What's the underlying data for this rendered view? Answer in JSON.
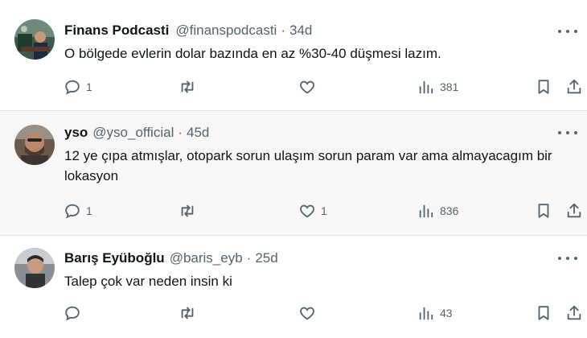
{
  "tweets": [
    {
      "name": "Finans Podcasti",
      "handle": "@finanspodcasti",
      "separator": "·",
      "time": "34d",
      "text": "O bölgede evlerin dolar bazında en az %30-40 düşmesi lazım.",
      "replies": "1",
      "retweets": "",
      "likes": "",
      "views": "381"
    },
    {
      "name": "yso",
      "handle": "@yso_official",
      "separator": "·",
      "time": "45d",
      "text": "12 ye çıpa atmışlar, otopark sorun ulaşım sorun param var ama almayacagım bir lokasyon",
      "replies": "1",
      "retweets": "",
      "likes": "1",
      "views": "836"
    },
    {
      "name": "Barış Eyüboğlu",
      "handle": "@baris_eyb",
      "separator": "·",
      "time": "25d",
      "text": "Talep çok var neden insin ki",
      "replies": "",
      "retweets": "",
      "likes": "",
      "views": "43"
    }
  ],
  "icons": {
    "reply": "reply-icon",
    "retweet": "retweet-icon",
    "like": "heart-icon",
    "views": "views-chart-icon",
    "bookmark": "bookmark-icon",
    "share": "share-icon",
    "more": "more-dots-icon"
  },
  "colors": {
    "text": "#0f1419",
    "secondary": "#536471",
    "highlighted_bg": "#f7f7f7",
    "divider": "#dfe3e6"
  }
}
